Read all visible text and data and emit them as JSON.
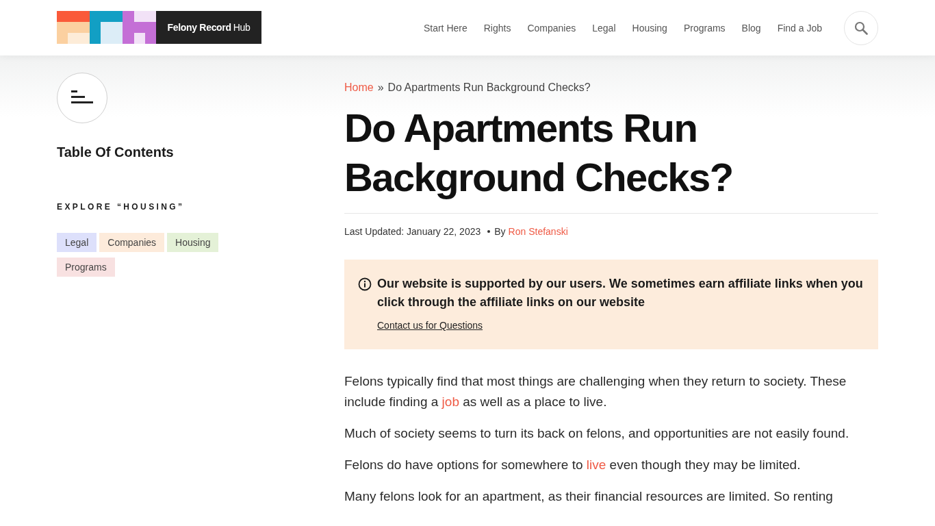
{
  "site": {
    "name_bold": "Felony Record",
    "name_rest": "Hub"
  },
  "nav": [
    {
      "label": "Start Here"
    },
    {
      "label": "Rights"
    },
    {
      "label": "Companies"
    },
    {
      "label": "Legal"
    },
    {
      "label": "Housing"
    },
    {
      "label": "Programs"
    },
    {
      "label": "Blog"
    },
    {
      "label": "Find a Job"
    }
  ],
  "sidebar": {
    "toc_title": "Table Of Contents",
    "explore_heading": "EXPLORE “HOUSING”",
    "tags": [
      {
        "label": "Legal",
        "color": "#dde0fb"
      },
      {
        "label": "Companies",
        "color": "#fdebdb"
      },
      {
        "label": "Housing",
        "color": "#e4f1d7"
      },
      {
        "label": "Programs",
        "color": "#f8e1e1"
      }
    ]
  },
  "breadcrumb": {
    "home": "Home",
    "separator": "»",
    "current": "Do Apartments Run Background Checks?"
  },
  "title": "Do Apartments Run Background Checks?",
  "meta": {
    "updated": "Last Updated: January 22, 2023",
    "by": "By",
    "author": "Ron Stefanski"
  },
  "notice": {
    "text": "Our website is supported by our users. We sometimes earn affiliate links when you click through the affiliate links on our website",
    "link": "Contact us for Questions"
  },
  "paragraphs": [
    [
      {
        "kind": "text",
        "text": "Felons typically find that most things are challenging when they return to society. These include finding a "
      },
      {
        "kind": "link",
        "text": "job"
      },
      {
        "kind": "text",
        "text": " as well as a place to live."
      }
    ],
    [
      {
        "kind": "text",
        "text": "Much of society seems to turn its back on felons, and opportunities are not easily found."
      }
    ],
    [
      {
        "kind": "text",
        "text": "Felons do have options for somewhere to "
      },
      {
        "kind": "link",
        "text": "live"
      },
      {
        "kind": "text",
        "text": " even though they may be limited."
      }
    ],
    [
      {
        "kind": "text",
        "text": "Many felons look for an apartment, as their financial resources are limited.  So renting"
      }
    ]
  ]
}
